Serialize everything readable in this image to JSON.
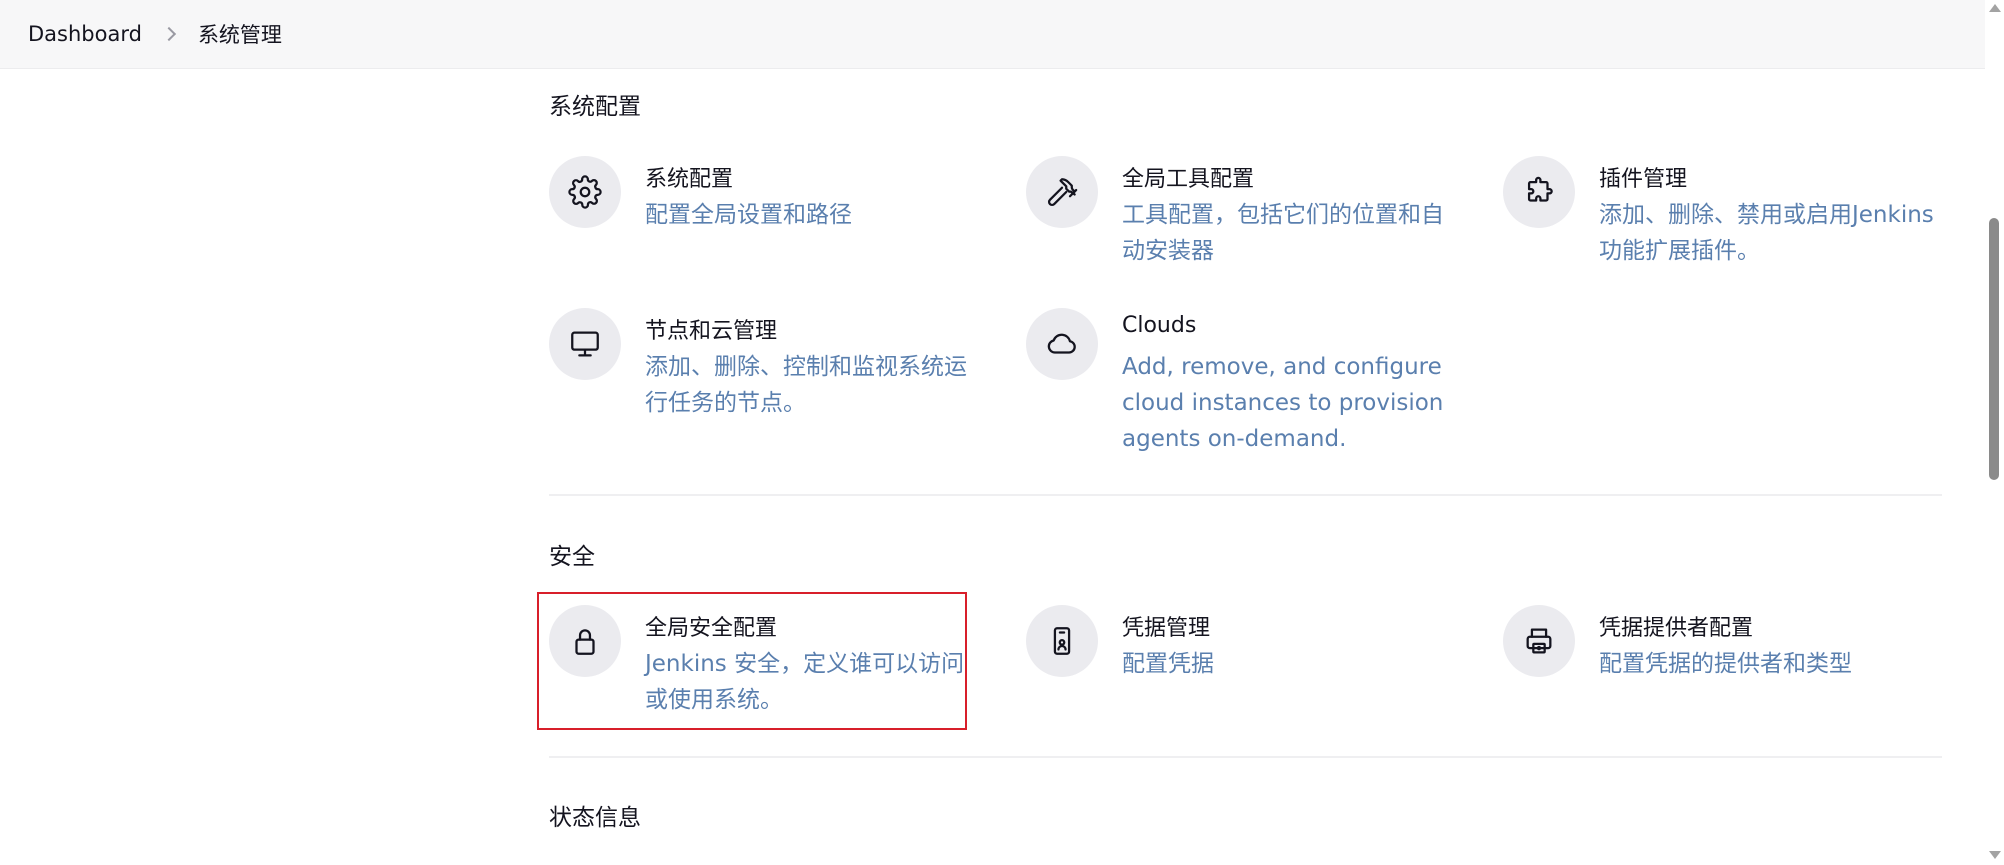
{
  "breadcrumb": {
    "root": "Dashboard",
    "current": "系统管理"
  },
  "sections": [
    {
      "title": "系统配置",
      "items": [
        {
          "title": "系统配置",
          "desc": "配置全局设置和路径",
          "icon": "gear-icon"
        },
        {
          "title": "全局工具配置",
          "desc": "工具配置，包括它们的位置和自动安装器",
          "icon": "hammer-icon"
        },
        {
          "title": "插件管理",
          "desc": "添加、删除、禁用或启用Jenkins功能扩展插件。",
          "icon": "puzzle-icon"
        },
        {
          "title": "节点和云管理",
          "desc": "添加、删除、控制和监视系统运行任务的节点。",
          "icon": "monitor-icon"
        },
        {
          "title": "Clouds",
          "desc": "Add, remove, and configure cloud instances to provision agents on-demand.",
          "icon": "cloud-icon"
        }
      ]
    },
    {
      "title": "安全",
      "items": [
        {
          "title": "全局安全配置",
          "desc": "Jenkins 安全，定义谁可以访问或使用系统。",
          "icon": "lock-icon"
        },
        {
          "title": "凭据管理",
          "desc": "配置凭据",
          "icon": "id-card-icon"
        },
        {
          "title": "凭据提供者配置",
          "desc": "配置凭据的提供者和类型",
          "icon": "provider-icon"
        }
      ]
    },
    {
      "title": "状态信息"
    }
  ],
  "colors": {
    "accent_text": "#5a7fae",
    "highlight": "#d81f2a",
    "icon_bg": "#ebebef"
  }
}
